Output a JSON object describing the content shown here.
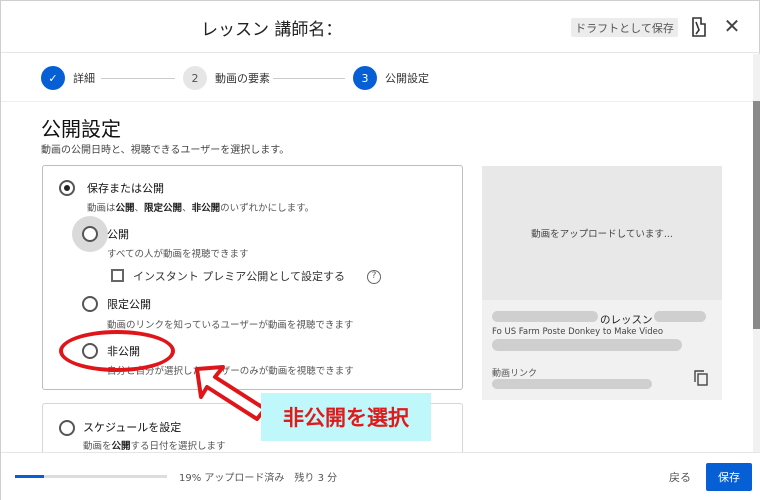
{
  "header": {
    "title": "レッスン 講師名：",
    "draft_button": "ドラフトとして保存"
  },
  "stepper": {
    "steps": [
      {
        "label": "詳細",
        "number": "✓"
      },
      {
        "label": "動画の要素",
        "number": "2"
      },
      {
        "label": "公開設定",
        "number": "3"
      }
    ]
  },
  "visibility": {
    "title": "公開設定",
    "subtitle": "動画の公開日時と、視聴できるユーザーを選択します。",
    "save_or_publish": {
      "label": "保存または公開",
      "desc_1": "動画は",
      "desc_b1": "公開",
      "desc_2": "、",
      "desc_b2": "限定公開",
      "desc_3": "、",
      "desc_b3": "非公開",
      "desc_4": "のいずれかにします。"
    },
    "public": {
      "label": "公開",
      "desc": "すべての人が動画を視聴できます"
    },
    "premiere": {
      "label": "インスタント プレミア公開として設定する",
      "help": "?"
    },
    "unlisted": {
      "label": "限定公開",
      "desc": "動画のリンクを知っているユーザーが動画を視聴できます"
    },
    "private": {
      "label": "非公開",
      "desc": "自分と自分が選択したユーザーのみが動画を視聴できます"
    },
    "schedule": {
      "label": "スケジュールを設定",
      "desc_1": "動画を",
      "desc_b": "公開",
      "desc_2": "する日付を選択します"
    }
  },
  "annotation": {
    "text": "非公開を選択"
  },
  "preview": {
    "uploading": "動画をアップロードしています...",
    "title_suffix": "のレッスン",
    "title_line2": "Fo US Farm Poste Donkey to Make Video",
    "link_label": "動画リンク"
  },
  "footer": {
    "progress": 19,
    "progress_text": "19% アップロード済み　残り 3 分",
    "back": "戻る",
    "save": "保存"
  },
  "colors": {
    "accent": "#065fd4",
    "annotation_red": "#e0151a",
    "annotation_bg": "#bff7fb"
  }
}
